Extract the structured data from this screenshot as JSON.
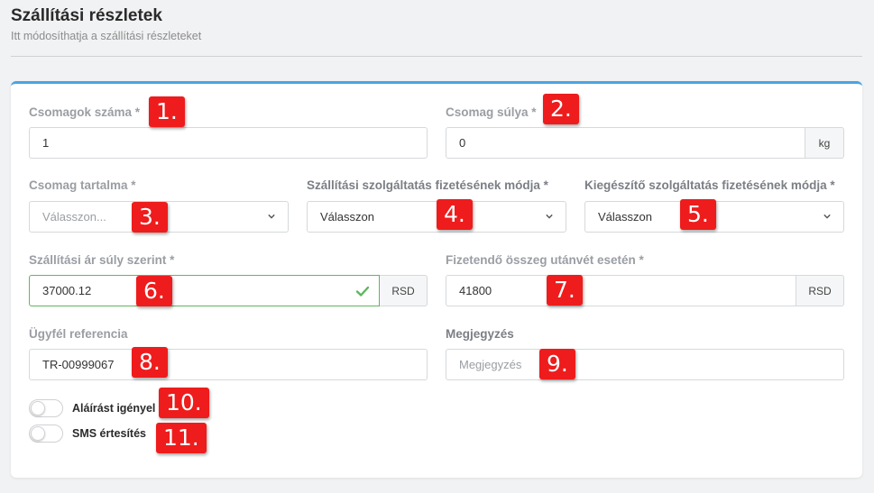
{
  "header": {
    "title": "Szállítási részletek",
    "subtitle": "Itt módosíthatja a szállítási részleteket"
  },
  "form": {
    "package_count": {
      "label": "Csomagok száma *",
      "value": "1"
    },
    "package_weight": {
      "label": "Csomag súlya *",
      "value": "0",
      "unit": "kg"
    },
    "package_content": {
      "label": "Csomag tartalma *",
      "placeholder": "Válasszon..."
    },
    "shipping_payment": {
      "label": "Szállítási szolgáltatás fizetésének módja *",
      "value": "Válasszon"
    },
    "extra_payment": {
      "label": "Kiegészítő szolgáltatás fizetésének módja *",
      "value": "Válasszon"
    },
    "shipping_price": {
      "label": "Szállítási ár súly szerint *",
      "value": "37000.12",
      "unit": "RSD"
    },
    "cod_amount": {
      "label": "Fizetendő összeg utánvét esetén *",
      "value": "41800",
      "unit": "RSD"
    },
    "customer_reference": {
      "label": "Ügyfél referencia",
      "value": "TR-00999067"
    },
    "note": {
      "label": "Megjegyzés",
      "placeholder": "Megjegyzés"
    },
    "signature_toggle": {
      "label": "Aláírást igényel",
      "checked": false
    },
    "sms_toggle": {
      "label": "SMS értesítés",
      "checked": false
    }
  },
  "annotations": {
    "b1": "1.",
    "b2": "2.",
    "b3": "3.",
    "b4": "4.",
    "b5": "5.",
    "b6": "6.",
    "b7": "7.",
    "b8": "8.",
    "b9": "9.",
    "b10": "10.",
    "b11": "11."
  },
  "icons": {
    "select_arrow": "chevron-down-icon",
    "valid": "check-icon"
  },
  "colors": {
    "accent": "#4aa3e3",
    "valid": "#5cb85c",
    "badge": "#ee1c1c"
  }
}
